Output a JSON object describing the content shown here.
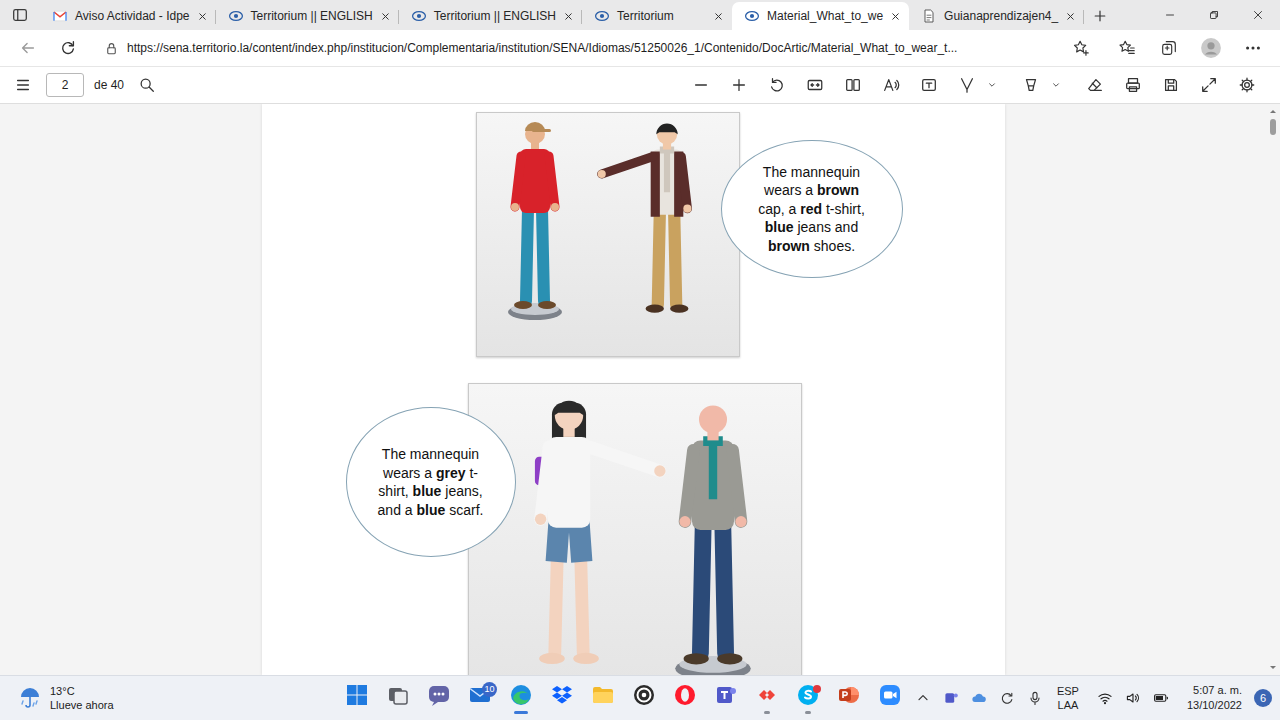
{
  "browser": {
    "tabs": [
      {
        "label": "Aviso Actividad - Idpe",
        "kind": "gmail",
        "selected": false
      },
      {
        "label": "Territorium || ENGLISH",
        "kind": "territorium",
        "selected": false
      },
      {
        "label": "Territorium || ENGLISH",
        "kind": "territorium",
        "selected": false
      },
      {
        "label": "Territorium",
        "kind": "territorium",
        "selected": false
      },
      {
        "label": "Material_What_to_we",
        "kind": "territorium",
        "selected": true
      },
      {
        "label": "Guianaprendizajen4_",
        "kind": "document",
        "selected": false
      }
    ],
    "url": "https://sena.territorio.la/content/index.php/institucion/Complementaria/institution/SENA/Idiomas/51250026_1/Contenido/DocArtic/Material_What_to_wear_t..."
  },
  "pdf_toolbar": {
    "page": "2",
    "page_count": "de 40"
  },
  "document": {
    "figures": [
      {
        "bubble": [
          {
            "text": "The mannequin wears a ",
            "bold": false
          },
          {
            "text": "brown",
            "bold": true
          },
          {
            "text": " cap, a ",
            "bold": false
          },
          {
            "text": "red",
            "bold": true
          },
          {
            "text": " t-shirt, ",
            "bold": false
          },
          {
            "text": "blue",
            "bold": true
          },
          {
            "text": " jeans and ",
            "bold": false
          },
          {
            "text": "brown",
            "bold": true
          },
          {
            "text": " shoes.",
            "bold": false
          }
        ]
      },
      {
        "bubble": [
          {
            "text": "The mannequin wears a ",
            "bold": false
          },
          {
            "text": "grey",
            "bold": true
          },
          {
            "text": " t-shirt, ",
            "bold": false
          },
          {
            "text": "blue",
            "bold": true
          },
          {
            "text": " jeans, and a ",
            "bold": false
          },
          {
            "text": "blue",
            "bold": true
          },
          {
            "text": " scarf.",
            "bold": false
          }
        ]
      }
    ]
  },
  "taskbar": {
    "weather": {
      "temperature": "13°C",
      "condition": "Llueve ahora"
    },
    "apps": [
      {
        "kind": "start",
        "running": false,
        "alert": false
      },
      {
        "kind": "task-view",
        "running": false,
        "alert": false
      },
      {
        "kind": "chat",
        "running": false,
        "alert": false
      },
      {
        "kind": "mail",
        "running": false,
        "alert": false,
        "badge": "10"
      },
      {
        "kind": "edge",
        "running": true,
        "alert": false
      },
      {
        "kind": "dropbox",
        "running": false,
        "alert": false
      },
      {
        "kind": "explorer",
        "running": false,
        "alert": false
      },
      {
        "kind": "obs",
        "running": false,
        "alert": false
      },
      {
        "kind": "opera",
        "running": false,
        "alert": false
      },
      {
        "kind": "teams",
        "running": false,
        "alert": false
      },
      {
        "kind": "anydesk",
        "running": true,
        "alert": false
      },
      {
        "kind": "skype",
        "running": true,
        "alert": true
      },
      {
        "kind": "powerpoint",
        "running": false,
        "alert": false
      },
      {
        "kind": "zoom",
        "running": false,
        "alert": false
      }
    ],
    "language": [
      "ESP",
      "LAA"
    ],
    "time": "5:07 a. m.",
    "date": "13/10/2022",
    "notifications": "6"
  }
}
